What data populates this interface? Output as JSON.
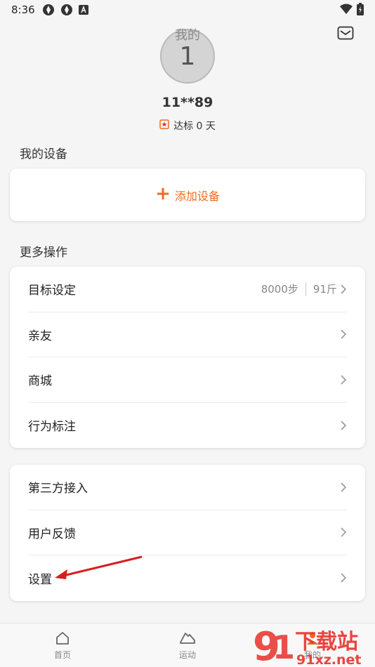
{
  "status": {
    "time": "8:36"
  },
  "header": {
    "title": "我的"
  },
  "profile": {
    "avatar_text": "1",
    "username": "11**89",
    "goal_days": "达标 0 天"
  },
  "devices": {
    "section_title": "我的设备",
    "add_label": "添加设备"
  },
  "more_ops": {
    "section_title": "更多操作",
    "items": [
      {
        "label": "目标设定",
        "steps": "8000步",
        "weight": "91斤"
      },
      {
        "label": "亲友"
      },
      {
        "label": "商城"
      },
      {
        "label": "行为标注"
      }
    ]
  },
  "other": {
    "items": [
      {
        "label": "第三方接入"
      },
      {
        "label": "用户反馈"
      },
      {
        "label": "设置"
      }
    ]
  },
  "nav": {
    "items": [
      {
        "label": "首页",
        "icon": "home-icon"
      },
      {
        "label": "运动",
        "icon": "shoe-icon"
      },
      {
        "label": "我的",
        "icon": "person-icon"
      }
    ]
  },
  "watermark": {
    "text_main": "下载站",
    "text_url": "91xz.net"
  },
  "colors": {
    "accent": "#f06a1f",
    "background": "#f5f5f5",
    "watermark": "#e8302a"
  }
}
